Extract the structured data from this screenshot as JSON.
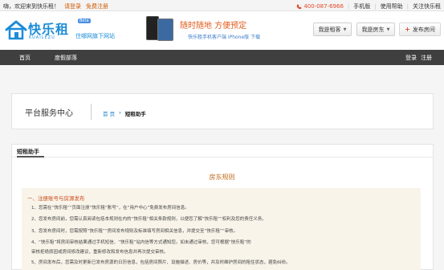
{
  "topbar": {
    "welcome": "嗨，欢迎来到快乐租！",
    "login": "请登录",
    "register": "免费注册",
    "phone": "400-087-6966",
    "mobile_version": "手机版",
    "help": "使用帮助",
    "follow": "关注快乐租"
  },
  "header": {
    "brand": "快乐租",
    "brand_en": "KUAILEZU",
    "beta": "Beta",
    "slogan": "住哪网旗下网站",
    "promo_title": "随时随地 方便预定",
    "promo_sub": "快乐租手机客户端 iPhone版 下载",
    "tenant_button": "我是租客",
    "landlord_button": "我是房东",
    "publish_button": "发布房间"
  },
  "nav": {
    "home": "首页",
    "tour": "度假部落",
    "login": "登录",
    "register": "注册"
  },
  "center": {
    "title": "平台服务中心",
    "crumb_home": "首 页",
    "crumb_sep": "›",
    "crumb_current": "短租助手"
  },
  "content": {
    "head_title": "短租助手",
    "rules_title": "房东规则",
    "section_title": "一、注册账号与房源发布",
    "lines": [
      "1、您需在“快乐租”“页面注册”快乐租“账号”，在“用户中心”免费发布房间信息。",
      "2、您发布房间前，您需认真阅读包括本规则在内的“快乐租”相关条款规则，以便您了解“快乐租”“权利及您的责任义务。",
      "3、您发布房间时，您需按照“快乐租”“房间发布规则及标准填写房间相关信息，并提交至“快乐租”“审核。",
      "4、“快乐租”将房间审核结果通过手机短信、“快乐租”站内信等方式通知您。如未通过审核，您可根据“快乐租”的",
      "审核拒绝原因或房间修改建议，重新修改和发布信息并再次提交审核。",
      "5、房间发布后，您需及时更新已发布房源的日历信息，包括房间照片、设施描述、房价等，并及时维护房间的租住状态，避免纠纷。"
    ]
  },
  "colors": {
    "brand_blue": "#1b8cd8",
    "nav_bg": "#3f3f3f",
    "accent_orange": "#c26a1a",
    "section_red": "#c94c1c"
  }
}
